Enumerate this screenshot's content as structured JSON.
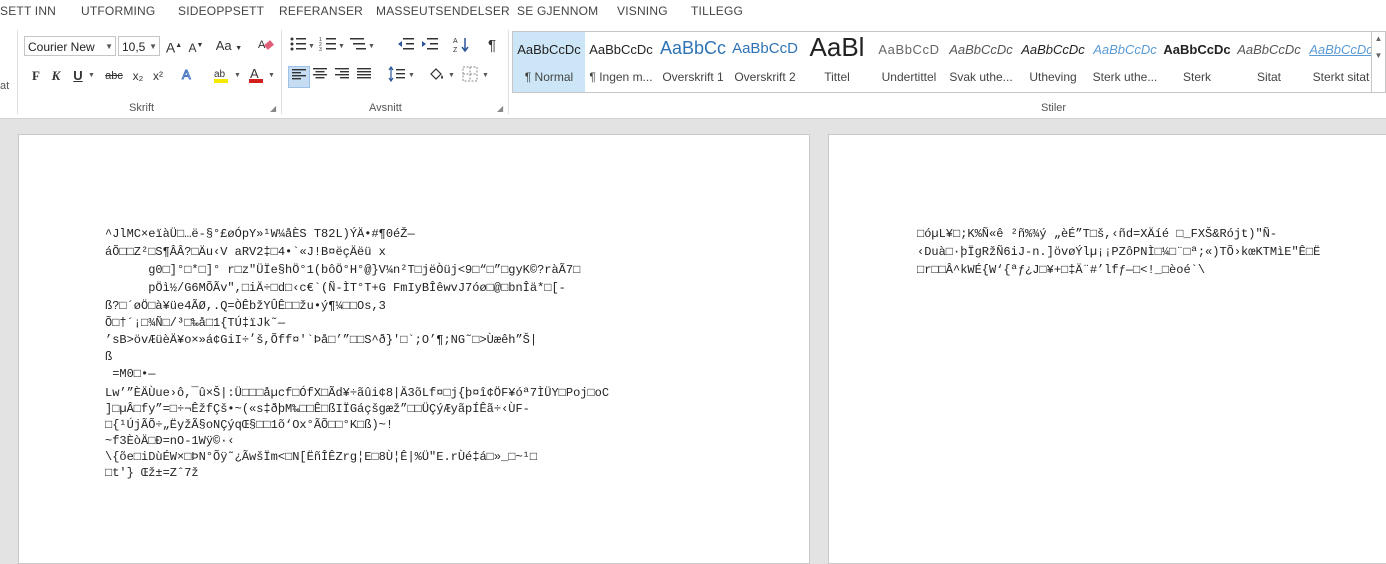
{
  "tabs": [
    "SETT INN",
    "UTFORMING",
    "SIDEOPPSETT",
    "REFERANSER",
    "MASSEUTSENDELSER",
    "SE GJENNOM",
    "VISNING",
    "TILLEGG"
  ],
  "ribbon": {
    "font_name": "Courier New",
    "font_size": "10,5",
    "left_cut_label": "at",
    "groups": {
      "skrift": "Skrift",
      "avsnitt": "Avsnitt",
      "stiler": "Stiler"
    },
    "format_buttons": {
      "bold": "F",
      "italic": "K",
      "underline": "U",
      "strike": "abc",
      "subscript": "x₂",
      "superscript": "x²"
    },
    "case_button": "Aa",
    "grow_font": "A",
    "shrink_font": "A",
    "highlight_color": "#f5e900",
    "font_color": "#d1201f",
    "accent_color": "#2b579a"
  },
  "styles": [
    {
      "preview": "AaBbCcDc",
      "name": "¶ Normal"
    },
    {
      "preview": "AaBbCcDc",
      "name": "¶ Ingen m..."
    },
    {
      "preview": "AaBbCc",
      "name": "Overskrift 1"
    },
    {
      "preview": "AaBbCcD",
      "name": "Overskrift 2"
    },
    {
      "preview": "AaBl",
      "name": "Tittel"
    },
    {
      "preview": "AaBbCcD",
      "name": "Undertittel"
    },
    {
      "preview": "AaBbCcDc",
      "name": "Svak uthe..."
    },
    {
      "preview": "AaBbCcDc",
      "name": "Utheving"
    },
    {
      "preview": "AaBbCcDc",
      "name": "Sterk uthe..."
    },
    {
      "preview": "AaBbCcDc",
      "name": "Sterk"
    },
    {
      "preview": "AaBbCcDc",
      "name": "Sitat"
    },
    {
      "preview": "AaBbCcDc",
      "name": "Sterkt sitat"
    }
  ],
  "page1_lines": [
    "^JlMC×eïàÜ□…ë-§°£øÓpY»¹W¼åÈS T82L)ÝÄ•#¶0éŽ—",
    "áÕ□□Z²□S¶ÂÂ?□Äu‹V aRV2‡□4•`«J!B¤ëçÄëü x",
    "      g0□]°□*□]° r□z\"ÜÏe§hÖ°1(bôÖ°H°@}V¼n²T□jëÒüj<9□“□”□gyK©?ràÃ7□",
    "      pÖì½/G6MÕÃv″,□iÄ÷□d□‹c€`(Ñ-ÌT°T+G FmIyBÎêwvJ7óø□@□bnÎä*□[-",
    "ß?□´øÖ□à¥üe4ÃØ,.Q=ÒÊbžYÛÊ□□žu•ý¶¼□□Os,3",
    "Õ□†´¡□¾Ñ□/³□‰å□1{TÚ‡ïJk˜—",
    "’sB>övÆüèÄ¥o×»á¢GiI÷׳š,Õff¤'`Þå□’”□□S^ð}'□`;O’¶;NG˜□>Ùæêh”Š|",
    "ß",
    " =M0□•—",
    "Lw’”ÈÄÙue›ô,¯û×Š|:Ü□□□åµcf□ÓfX□Ãd¥÷ãûi¢8|Ä3õLf¤□j{þ¤î¢ÖF¥óª7ÌÜY□Poj□oC",
    "]□µÂ□fy”=□÷¬ÊžfÇš•~(«s‡ðþM‰□□Ê□ßIÏGáçšgæž”□□ÜÇýÆyãpÍÊã÷‹ÙF-",
    "□{¹ÚjÃÕ÷„ËyžÃ§oNÇýqŒ§□□1õ‘Ox°ÃÕ□□°K□ß)~!",
    "~f3ÈòÄ□Ð=nO-1Wÿ©·‹",
    "\\{õe□iDùÉW×□ÞN°Õÿ˜¿ÃwšÏm<□N[ËñÎÊZrg¦E□8Ù¦Ê|%Ü\"E.rÙé‡á□»_□~¹□",
    "□t'} Œž±=Zˆ7ž"
  ],
  "page2_lines": [
    "□óµL¥□;K%Ñ«ê ²ñ%¾ý „èÉ”T□š,‹ñd=XÄíé □_FXŠ&Rójt)\"Ñ-",
    "‹Duà□·þÏgRžÑ6iJ-n.]övøÝlµ¡¡PZôPNÌ□¼□¨□ª;«)TÕ›kœKTMìE\"Ê□Ë",
    "□r□□Â^kWÉ{W‘{ªƒ¿J□¥+□‡Ä¨#’lfƒ—□<!_□èoé`\\"
  ]
}
